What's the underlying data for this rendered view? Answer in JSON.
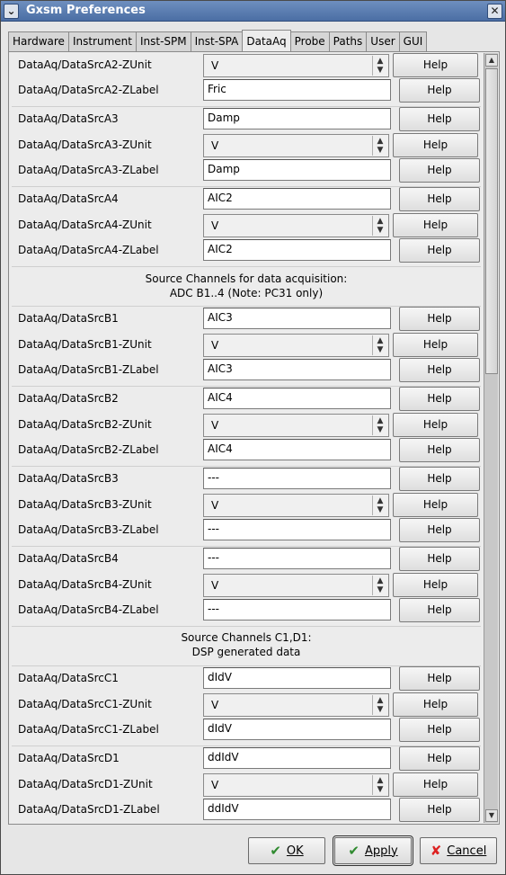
{
  "window": {
    "title": "Gxsm Preferences"
  },
  "tabs": [
    "Hardware",
    "Instrument",
    "Inst-SPM",
    "Inst-SPA",
    "DataAq",
    "Probe",
    "Paths",
    "User",
    "GUI"
  ],
  "active_tab": "DataAq",
  "help_label": "Help",
  "sections": {
    "b": [
      "Source Channels for data acquisition:",
      "ADC B1..4 (Note: PC31 only)"
    ],
    "c": [
      "Source Channels C1,D1:",
      "DSP generated data"
    ]
  },
  "rows": [
    {
      "label": "DataAq/DataSrcA2-ZUnit",
      "kind": "combo",
      "value": "V"
    },
    {
      "label": "DataAq/DataSrcA2-ZLabel",
      "kind": "entry",
      "value": "Fric"
    },
    {
      "label": "DataAq/DataSrcA3",
      "kind": "entry",
      "value": "Damp"
    },
    {
      "label": "DataAq/DataSrcA3-ZUnit",
      "kind": "combo",
      "value": "V"
    },
    {
      "label": "DataAq/DataSrcA3-ZLabel",
      "kind": "entry",
      "value": "Damp"
    },
    {
      "label": "DataAq/DataSrcA4",
      "kind": "entry",
      "value": "AIC2"
    },
    {
      "label": "DataAq/DataSrcA4-ZUnit",
      "kind": "combo",
      "value": "V"
    },
    {
      "label": "DataAq/DataSrcA4-ZLabel",
      "kind": "entry",
      "value": "AIC2"
    },
    {
      "label": "DataAq/DataSrcB1",
      "kind": "entry",
      "value": "AIC3"
    },
    {
      "label": "DataAq/DataSrcB1-ZUnit",
      "kind": "combo",
      "value": "V"
    },
    {
      "label": "DataAq/DataSrcB1-ZLabel",
      "kind": "entry",
      "value": "AIC3"
    },
    {
      "label": "DataAq/DataSrcB2",
      "kind": "entry",
      "value": "AIC4"
    },
    {
      "label": "DataAq/DataSrcB2-ZUnit",
      "kind": "combo",
      "value": "V"
    },
    {
      "label": "DataAq/DataSrcB2-ZLabel",
      "kind": "entry",
      "value": "AIC4"
    },
    {
      "label": "DataAq/DataSrcB3",
      "kind": "entry",
      "value": "---"
    },
    {
      "label": "DataAq/DataSrcB3-ZUnit",
      "kind": "combo",
      "value": "V"
    },
    {
      "label": "DataAq/DataSrcB3-ZLabel",
      "kind": "entry",
      "value": "---"
    },
    {
      "label": "DataAq/DataSrcB4",
      "kind": "entry",
      "value": "---"
    },
    {
      "label": "DataAq/DataSrcB4-ZUnit",
      "kind": "combo",
      "value": "V"
    },
    {
      "label": "DataAq/DataSrcB4-ZLabel",
      "kind": "entry",
      "value": "---"
    },
    {
      "label": "DataAq/DataSrcC1",
      "kind": "entry",
      "value": "dIdV"
    },
    {
      "label": "DataAq/DataSrcC1-ZUnit",
      "kind": "combo",
      "value": "V"
    },
    {
      "label": "DataAq/DataSrcC1-ZLabel",
      "kind": "entry",
      "value": "dIdV"
    },
    {
      "label": "DataAq/DataSrcD1",
      "kind": "entry",
      "value": "ddIdV"
    },
    {
      "label": "DataAq/DataSrcD1-ZUnit",
      "kind": "combo",
      "value": "V"
    },
    {
      "label": "DataAq/DataSrcD1-ZLabel",
      "kind": "entry",
      "value": "ddIdV"
    }
  ],
  "buttons": {
    "ok": "OK",
    "apply": "Apply",
    "cancel": "Cancel"
  },
  "icons": {
    "ok": "check-icon",
    "apply": "check-icon",
    "cancel": "cancel-icon"
  }
}
